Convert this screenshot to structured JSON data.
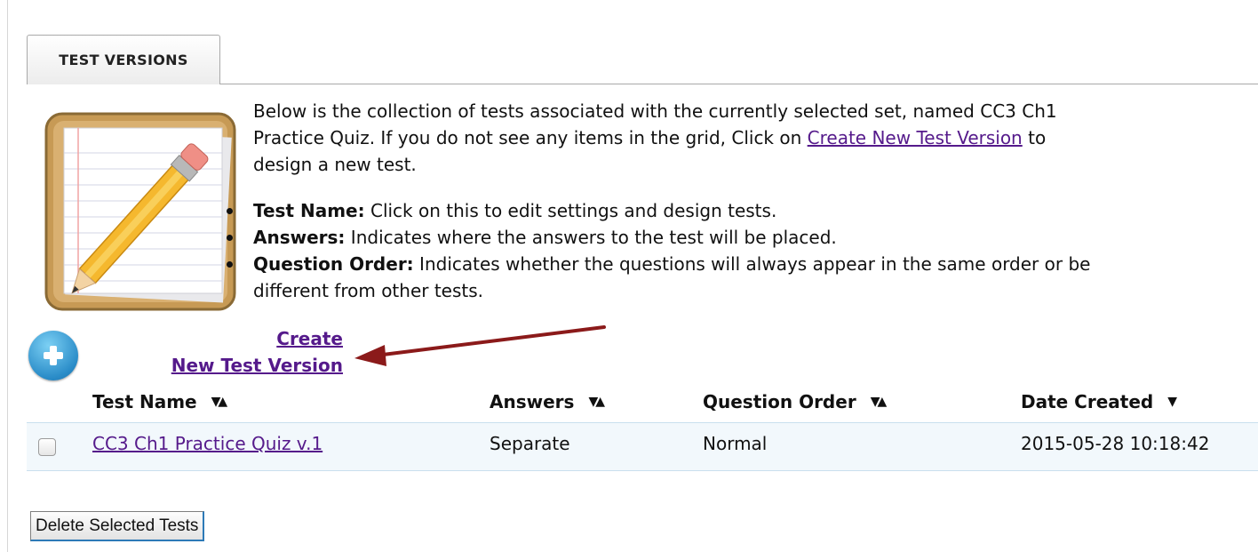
{
  "tab": {
    "label": "TEST VERSIONS"
  },
  "intro": {
    "text_before_link": "Below is the collection of tests associated with the currently selected set, named CC3 Ch1 Practice Quiz. If you do not see any items in the grid, Click on ",
    "link_text": "Create New Test Version",
    "text_after_link": " to design a new test."
  },
  "bullets": [
    {
      "term": "Test Name:",
      "description": " Click on this to edit settings and design tests."
    },
    {
      "term": "Answers:",
      "description": " Indicates where the answers to the test will be placed."
    },
    {
      "term": "Question Order:",
      "description": " Indicates whether the questions will always appear in the same order or be different from other tests."
    }
  ],
  "create_link": {
    "line1": "Create",
    "line2": "New Test Version"
  },
  "table": {
    "columns": [
      {
        "label": "Test Name",
        "sort_icon": "▼▲"
      },
      {
        "label": "Answers",
        "sort_icon": "▼▲"
      },
      {
        "label": "Question Order",
        "sort_icon": "▼▲"
      },
      {
        "label": "Date Created",
        "sort_icon": "▼"
      }
    ],
    "rows": [
      {
        "test_name": "CC3 Ch1 Practice Quiz v.1",
        "answers": "Separate",
        "question_order": "Normal",
        "date_created": "2015-05-28 10:18:42"
      }
    ]
  },
  "delete_button": {
    "label": "Delete Selected Tests"
  },
  "colors": {
    "link": "#551a8b",
    "row_background": "#f2f8fc",
    "arrow": "#8b1a1a",
    "plus_icon": "#2a8cc8"
  },
  "icons": [
    "notepad-pencil-icon",
    "add-icon",
    "sort-icon",
    "checkbox"
  ]
}
